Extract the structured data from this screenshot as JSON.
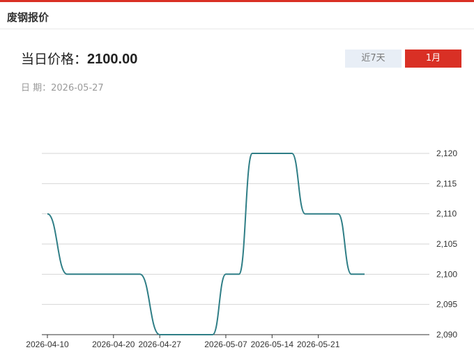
{
  "header": {
    "title": "废钢报价"
  },
  "price": {
    "label": "当日价格：",
    "value": "2100.00"
  },
  "date": {
    "label": "日 期：",
    "value": "2026-05-27"
  },
  "range_buttons": {
    "week": "近7天",
    "month": "1月",
    "active": "month"
  },
  "colors": {
    "accent": "#d93025",
    "line": "#2f7e86",
    "grid": "#d6d6d6"
  },
  "chart_data": {
    "type": "line",
    "x_tick_labels": [
      "2026-04-10",
      "2026-04-20",
      "2026-04-27",
      "2026-05-07",
      "2026-05-14",
      "2026-05-21"
    ],
    "y_tick_labels": [
      "2,090",
      "2,095",
      "2,100",
      "2,105",
      "2,110",
      "2,115",
      "2,120"
    ],
    "ylim": [
      2090,
      2120
    ],
    "y_axis_side": "right",
    "grid": "horizontal",
    "series": [
      {
        "points": [
          {
            "x": "2026-04-10",
            "y": 2110
          },
          {
            "x": "2026-04-13",
            "y": 2100
          },
          {
            "x": "2026-04-24",
            "y": 2100
          },
          {
            "x": "2026-04-27",
            "y": 2090
          },
          {
            "x": "2026-05-05",
            "y": 2090
          },
          {
            "x": "2026-05-07",
            "y": 2100
          },
          {
            "x": "2026-05-09",
            "y": 2100
          },
          {
            "x": "2026-05-11",
            "y": 2120
          },
          {
            "x": "2026-05-17",
            "y": 2120
          },
          {
            "x": "2026-05-19",
            "y": 2110
          },
          {
            "x": "2026-05-24",
            "y": 2110
          },
          {
            "x": "2026-05-26",
            "y": 2100
          },
          {
            "x": "2026-05-28",
            "y": 2100
          }
        ]
      }
    ]
  }
}
